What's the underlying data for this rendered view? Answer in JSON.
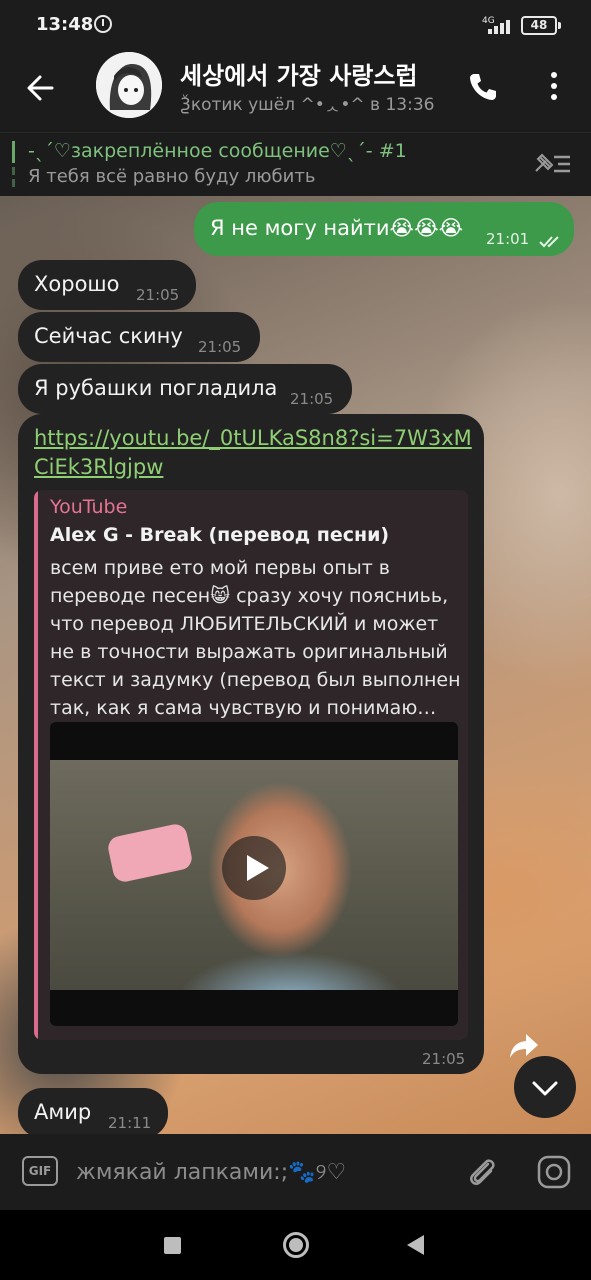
{
  "status_bar": {
    "time": "13:48",
    "network": "4G",
    "battery": "48"
  },
  "header": {
    "title": "세상에서 가장 사랑스럽",
    "subtitle": "Ѯкотик ушёл ^•ᆺ•^ в 13:36"
  },
  "pinned": {
    "title": "-ˎˊ♡закреплённое сообщение♡ˎˊ- #1",
    "text": "Я тебя всё равно буду любить"
  },
  "messages": [
    {
      "direction": "out",
      "text": "Я не могу найти😭😭😭",
      "time": "21:01",
      "read": true
    },
    {
      "direction": "in",
      "text": "Хорошо",
      "time": "21:05"
    },
    {
      "direction": "in",
      "text": "Сейчас скину",
      "time": "21:05"
    },
    {
      "direction": "in",
      "text": "Я рубашки погладила",
      "time": "21:05"
    },
    {
      "direction": "in",
      "link": "https://youtu.be/_0tULKaS8n8?si=7W3xMCiEk3Rlgjpw",
      "preview": {
        "site": "YouTube",
        "title": "Alex G - Break (перевод песни)",
        "description": "всем приве ето мой первы опыт в переводе песен😸 сразу хочу поясниьь, что перевод ЛЮБИТЕЛЬСКИЙ и может не в точности выражать оригинальный текст и задумку (перевод был выполнен так, как я сама чувствую и понимаю…"
      },
      "time": "21:05"
    },
    {
      "direction": "in",
      "text": "Амир",
      "time": "21:11"
    }
  ],
  "input": {
    "placeholder": "жмякай лапками:;🐾୨♡",
    "gif_label": "GIF"
  },
  "colors": {
    "outgoing_bubble": "#3d9a4a",
    "incoming_bubble": "#222222",
    "link": "#8fcf74",
    "youtube_accent": "#d86c8c",
    "pinned_accent": "#7ec27e"
  },
  "icons": [
    "back-arrow-icon",
    "phone-icon",
    "more-vertical-icon",
    "pinned-list-icon",
    "double-check-icon",
    "play-icon",
    "share-icon",
    "chevron-down-icon",
    "gif-icon",
    "paperclip-icon",
    "camera-icon",
    "recents-icon",
    "home-icon",
    "nav-back-icon"
  ]
}
